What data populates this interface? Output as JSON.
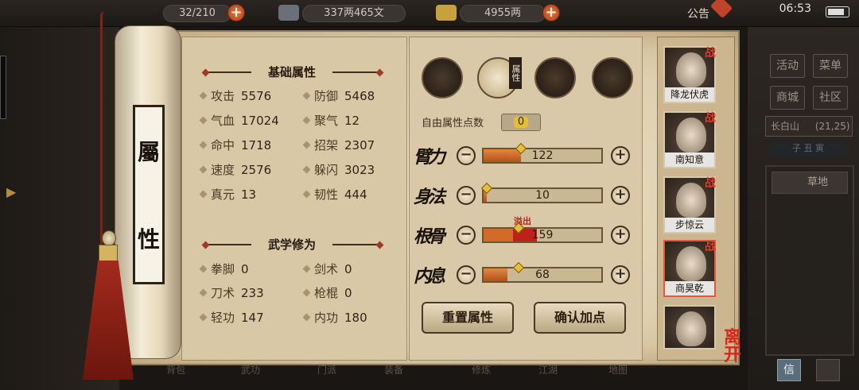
{
  "hud": {
    "stamina": "32/210",
    "stamina_label": "体力",
    "copper": "337两465文",
    "silver": "4955两",
    "announce": "公告",
    "clock": "06:53"
  },
  "scroll": {
    "title_top": "屬",
    "title_bottom": "性"
  },
  "basic": {
    "title": "基础属性",
    "stats": [
      {
        "label": "攻击",
        "value": "5576"
      },
      {
        "label": "防御",
        "value": "5468"
      },
      {
        "label": "气血",
        "value": "17024"
      },
      {
        "label": "聚气",
        "value": "12"
      },
      {
        "label": "命中",
        "value": "1718"
      },
      {
        "label": "招架",
        "value": "2307"
      },
      {
        "label": "速度",
        "value": "2576"
      },
      {
        "label": "躲闪",
        "value": "3023"
      },
      {
        "label": "真元",
        "value": "13"
      },
      {
        "label": "韧性",
        "value": "444"
      }
    ]
  },
  "martial": {
    "title": "武学修为",
    "stats": [
      {
        "label": "拳脚",
        "value": "0"
      },
      {
        "label": "剑术",
        "value": "0"
      },
      {
        "label": "刀术",
        "value": "233"
      },
      {
        "label": "枪棍",
        "value": "0"
      },
      {
        "label": "轻功",
        "value": "147"
      },
      {
        "label": "内功",
        "value": "180"
      }
    ]
  },
  "attributes": {
    "tab_badge": "属性",
    "free_points_label": "自由属性点数",
    "free_points": "0",
    "rows": [
      {
        "name": "臂力",
        "value": "122",
        "fill": 0.32,
        "knob": 0.32
      },
      {
        "name": "身法",
        "value": "10",
        "fill": 0.03,
        "knob": 0.03
      },
      {
        "name": "根骨",
        "value": "159",
        "fill": 0.45,
        "knob": 0.3
      },
      {
        "name": "内息",
        "value": "68",
        "fill": 0.2,
        "knob": 0.3
      }
    ],
    "overflow_label": "溢出",
    "reset_label": "重置属性",
    "confirm_label": "确认加点"
  },
  "party": [
    {
      "name": "降龙伏虎",
      "tag": "战"
    },
    {
      "name": "南知意",
      "tag": "战"
    },
    {
      "name": "步惊云",
      "tag": "战"
    },
    {
      "name": "商昊乾",
      "tag": "战"
    },
    {
      "name": "",
      "tag": ""
    }
  ],
  "leave_label": "离开",
  "side": {
    "btn1": "活动",
    "btn2": "菜单",
    "btn3": "商城",
    "btn4": "社区",
    "location": "长白山",
    "location_coords": "(21,25)",
    "time_row": "子 丑 寅",
    "terrain": "草地",
    "info": "信"
  },
  "dock": [
    "背包",
    "武功",
    "门派",
    "装备",
    "修炼",
    "江湖",
    "地图"
  ]
}
